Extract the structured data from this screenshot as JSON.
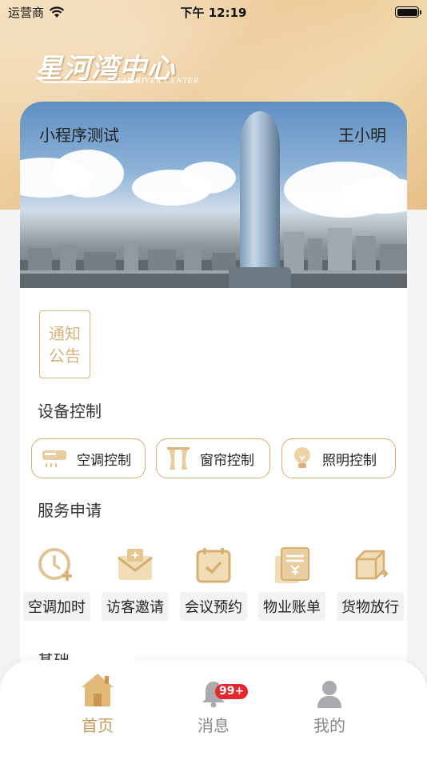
{
  "status": {
    "carrier": "运营商",
    "time": "下午 12:19"
  },
  "logo": {
    "cn": "星河湾中心",
    "en": "STAR RIVER CENTER"
  },
  "banner": {
    "title": "小程序测试",
    "user": "王小明"
  },
  "notice": {
    "line1": "通知",
    "line2": "公告"
  },
  "device": {
    "title": "设备控制",
    "items": [
      {
        "label": "空调控制",
        "icon": "air-conditioner-icon"
      },
      {
        "label": "窗帘控制",
        "icon": "curtain-icon"
      },
      {
        "label": "照明控制",
        "icon": "lightbulb-icon"
      }
    ]
  },
  "service": {
    "title": "服务申请",
    "items": [
      {
        "label": "空调加时",
        "icon": "clock-plus-icon"
      },
      {
        "label": "访客邀请",
        "icon": "envelope-icon"
      },
      {
        "label": "会议预约",
        "icon": "calendar-check-icon"
      },
      {
        "label": "物业账单",
        "icon": "bill-icon"
      },
      {
        "label": "货物放行",
        "icon": "box-out-icon"
      }
    ]
  },
  "basic": {
    "title": "基础"
  },
  "tabbar": {
    "items": [
      {
        "label": "首页",
        "icon": "home-icon",
        "active": true
      },
      {
        "label": "消息",
        "icon": "bell-icon",
        "badge": "99+"
      },
      {
        "label": "我的",
        "icon": "user-icon"
      }
    ]
  },
  "colors": {
    "accent": "#d4ad73",
    "active_tab": "#c99a5a",
    "badge": "#e5262d"
  }
}
